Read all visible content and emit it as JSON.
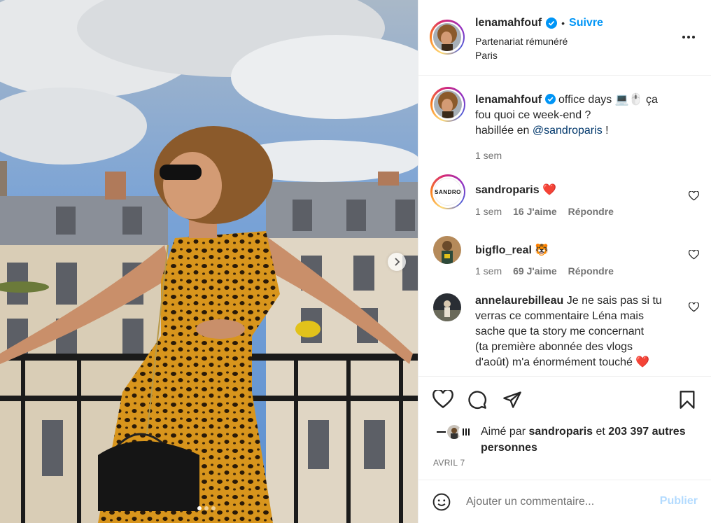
{
  "post": {
    "username": "lenamahfouf",
    "separator": "•",
    "follow_label": "Suivre",
    "partnership": "Partenariat rémunéré",
    "location": "Paris"
  },
  "caption": {
    "username": "lenamahfouf",
    "text_1": "office days 💻🖱️ ça",
    "text_2": "fou quoi ce week-end ?",
    "text_3a": "habillée en ",
    "mention": "@sandroparis",
    "text_3b": " !",
    "time": "1 sem"
  },
  "comments": [
    {
      "username": "sandroparis",
      "text": "❤️",
      "time": "1 sem",
      "likes": "16 J'aime",
      "reply": "Répondre",
      "avatar_label": "SANDRO"
    },
    {
      "username": "bigflo_real",
      "text": "🐯",
      "time": "1 sem",
      "likes": "69 J'aime",
      "reply": "Répondre"
    },
    {
      "username": "annelaurebilleau",
      "text_1": "Je ne sais pas si tu",
      "text_2": "verras ce commentaire Léna mais",
      "text_3": "sache que ta story me concernant",
      "text_4": "(ta première abonnée des vlogs",
      "text_5": "d'août) m'a énormément touché ❤️"
    }
  ],
  "likes": {
    "prefix": "Aimé par ",
    "user": "sandroparis",
    "middle": " et ",
    "count": "203 397 autres",
    "count_2": "personnes"
  },
  "date": "AVRIL 7",
  "add_comment": {
    "placeholder": "Ajouter un commentaire...",
    "publish_label": "Publier"
  },
  "carousel": {
    "slides": 3,
    "active": 1
  },
  "colors": {
    "accent": "#0095f6",
    "verified": "#0095f6",
    "heart": "#ed4956",
    "muted": "#737373",
    "publish_disabled": "#b3dbff"
  },
  "icons": [
    "verified-icon",
    "more-icon",
    "heart-icon",
    "comment-icon",
    "share-icon",
    "bookmark-icon",
    "emoji-icon",
    "chevron-right-icon"
  ]
}
